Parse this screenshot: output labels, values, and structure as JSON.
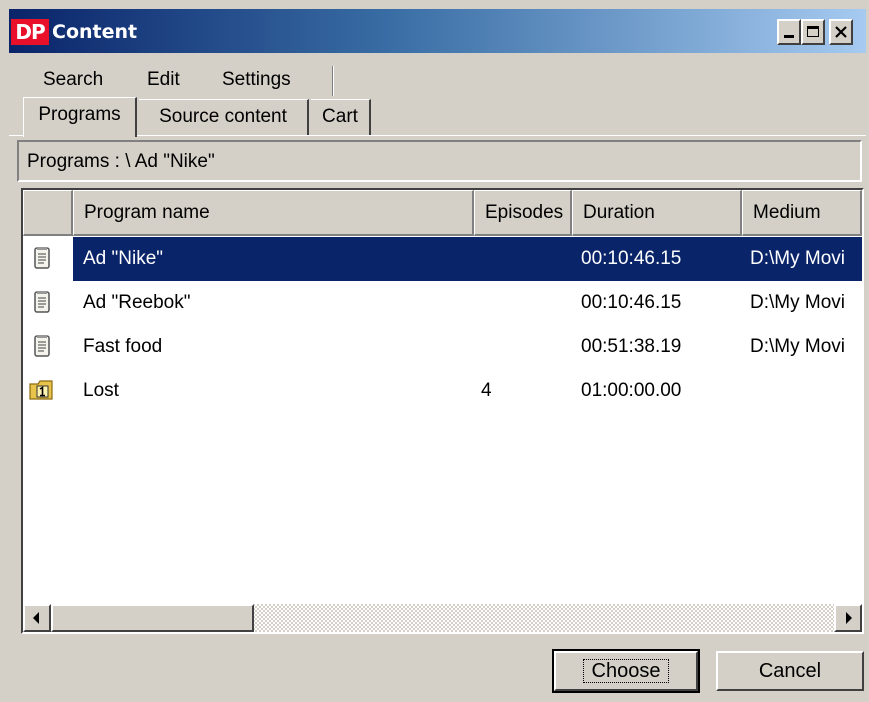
{
  "window": {
    "logo": "DP",
    "title": "Content"
  },
  "menu": {
    "items": [
      "Search",
      "Edit",
      "Settings"
    ]
  },
  "tabs": [
    {
      "label": "Programs",
      "active": true
    },
    {
      "label": "Source content",
      "active": false
    },
    {
      "label": "Cart",
      "active": false
    }
  ],
  "path": "Programs :  \\ Ad  \"Nike\"",
  "table": {
    "columns": [
      "",
      "Program name",
      "Episodes",
      "Duration",
      "Medium"
    ],
    "rows": [
      {
        "icon": "program-icon",
        "name": "Ad  \"Nike\"",
        "episodes": "",
        "duration": "00:10:46.15",
        "medium": "D:\\My Movi",
        "selected": true
      },
      {
        "icon": "program-icon",
        "name": "Ad \"Reebok\"",
        "episodes": "",
        "duration": "00:10:46.15",
        "medium": "D:\\My Movi",
        "selected": false
      },
      {
        "icon": "program-icon",
        "name": "Fast food",
        "episodes": "",
        "duration": "00:51:38.19",
        "medium": "D:\\My Movi",
        "selected": false
      },
      {
        "icon": "series-folder-icon",
        "name": "Lost",
        "episodes": "4",
        "duration": "01:00:00.00",
        "medium": "",
        "selected": false
      }
    ]
  },
  "buttons": {
    "choose": "Choose",
    "cancel": "Cancel"
  },
  "colors": {
    "selection": "#0a246a",
    "title_gradient_start": "#0a246a",
    "title_gradient_end": "#a6caf0",
    "logo": "#e8102a"
  }
}
